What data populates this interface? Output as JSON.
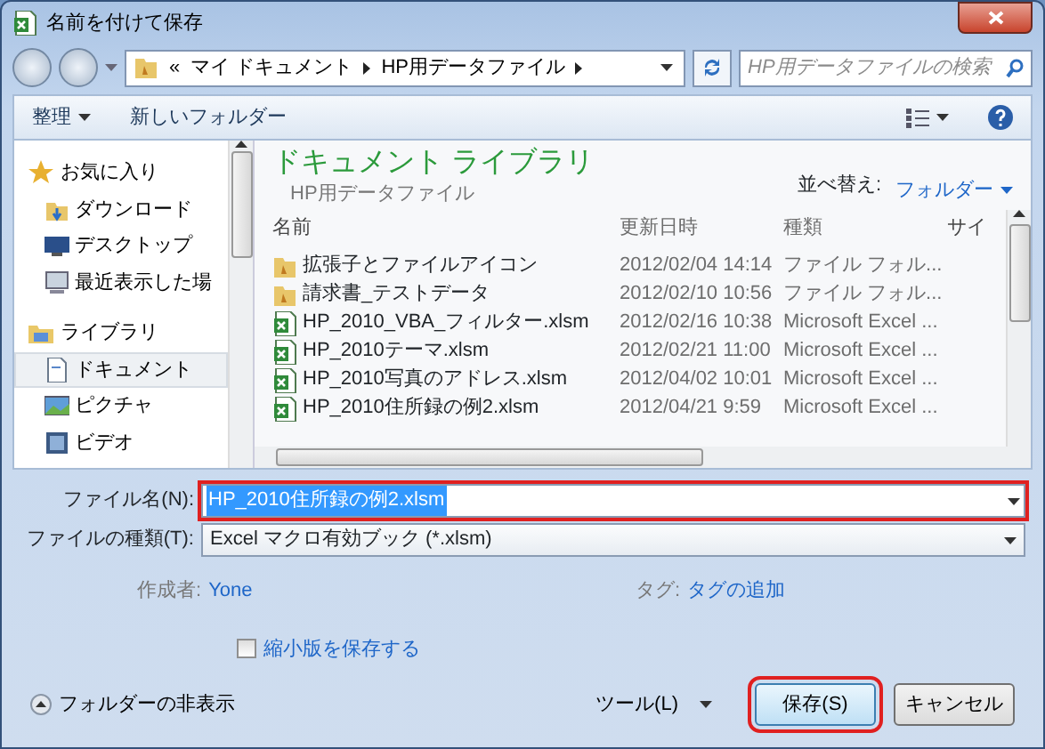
{
  "window": {
    "title": "名前を付けて保存"
  },
  "address": {
    "overflow": "«",
    "path": [
      "マイ ドキュメント",
      "HP用データファイル"
    ]
  },
  "search": {
    "placeholder": "HP用データファイルの検索"
  },
  "toolbar": {
    "organize": "整理",
    "new_folder": "新しいフォルダー"
  },
  "sidebar": [
    {
      "label": "お気に入り",
      "kind": "star",
      "children": [
        {
          "label": "ダウンロード",
          "kind": "download",
          "selected": false
        },
        {
          "label": "デスクトップ",
          "kind": "desktop",
          "selected": false
        },
        {
          "label": "最近表示した場",
          "kind": "recent",
          "selected": false
        }
      ]
    },
    {
      "label": "ライブラリ",
      "kind": "library",
      "children": [
        {
          "label": "ドキュメント",
          "kind": "document",
          "selected": true
        },
        {
          "label": "ピクチャ",
          "kind": "picture",
          "selected": false
        },
        {
          "label": "ビデオ",
          "kind": "video",
          "selected": false
        }
      ]
    }
  ],
  "library": {
    "title": "ドキュメント ライブラリ",
    "subtitle": "HP用データファイル",
    "sort_label": "並べ替え:",
    "sort_value": "フォルダー"
  },
  "columns": [
    "名前",
    "更新日時",
    "種類",
    "サイ"
  ],
  "files": [
    {
      "name": "拡張子とファイルアイコン",
      "date": "2012/02/04 14:14",
      "type": "ファイル フォル...",
      "kind": "folder"
    },
    {
      "name": "請求書_テストデータ",
      "date": "2012/02/10 10:56",
      "type": "ファイル フォル...",
      "kind": "folder"
    },
    {
      "name": "HP_2010_VBA_フィルター.xlsm",
      "date": "2012/02/16 10:38",
      "type": "Microsoft Excel ...",
      "kind": "excel"
    },
    {
      "name": "HP_2010テーマ.xlsm",
      "date": "2012/02/21 11:00",
      "type": "Microsoft Excel ...",
      "kind": "excel"
    },
    {
      "name": "HP_2010写真のアドレス.xlsm",
      "date": "2012/04/02 10:01",
      "type": "Microsoft Excel ...",
      "kind": "excel"
    },
    {
      "name": "HP_2010住所録の例2.xlsm",
      "date": "2012/04/21 9:59",
      "type": "Microsoft Excel ...",
      "kind": "excel"
    }
  ],
  "filename": {
    "label": "ファイル名(N):",
    "value": "HP_2010住所録の例2.xlsm",
    "highlighted": true
  },
  "filetype": {
    "label": "ファイルの種類(T):",
    "value": "Excel マクロ有効ブック (*.xlsm)"
  },
  "meta": [
    {
      "label": "作成者:",
      "value": "Yone"
    },
    {
      "label": "タグ:",
      "value": "タグの追加"
    }
  ],
  "thumbnail": {
    "label": "縮小版を保存する",
    "checked": false
  },
  "hide_folders": "フォルダーの非表示",
  "tools": "ツール(L)",
  "buttons": [
    {
      "label": "保存(S)",
      "highlighted": true
    },
    {
      "label": "キャンセル",
      "highlighted": false
    }
  ]
}
